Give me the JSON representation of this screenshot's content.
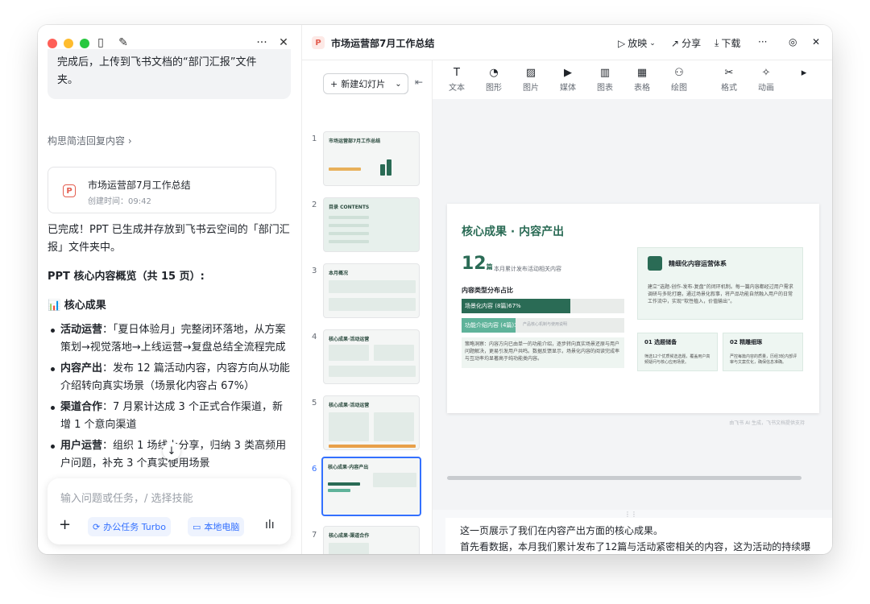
{
  "chat": {
    "top_bubble_line1": "完成后，上传到飞书文档的“部门汇报”文件",
    "top_bubble_line2": "夹。",
    "reply_link": "构思简洁回复内容 ›",
    "file_card": {
      "title": "市场运营部7月工作总结",
      "time": "创建时间：09:42"
    },
    "done_text": "已完成！PPT 已生成并存放到飞书云空间的「部门汇报」文件夹中。",
    "overview_heading": "PPT 核心内容概览（共 15 页）:",
    "results_heading": "📊 核心成果",
    "bullets": [
      {
        "label": "活动运营",
        "text": "：「夏日体验月」完整闭环落地，从方案策划→视觉落地→上线运营→复盘总结全流程完成"
      },
      {
        "label": "内容产出",
        "text": "：发布 12 篇活动内容，内容方向从功能介绍转向真实场景（场景化内容占 67%）"
      },
      {
        "label": "渠道合作",
        "text": "：7 月累计达成 3 个正式合作渠道，新增 1 个意向渠道"
      },
      {
        "label": "用户运营",
        "text": "：组织 1 场线上分享，归纳 3 类高频用户问题，补充 3 个真实使用场景"
      }
    ],
    "input_placeholder": "输入问题或任务，/ 选择技能",
    "chip_turbo": "办公任务 Turbo",
    "chip_local": "本地电脑"
  },
  "ppt": {
    "title": "市场运营部7月工作总结",
    "actions": {
      "play": "放映",
      "share": "分享",
      "download": "下载"
    },
    "new_slide": "新建幻灯片",
    "toolbar": [
      "文本",
      "图形",
      "图片",
      "媒体",
      "图表",
      "表格",
      "绘图",
      "格式",
      "动画"
    ],
    "thumbnails": [
      {
        "num": "1",
        "title": "市场运营部7月工作总结"
      },
      {
        "num": "2",
        "title": "目录 CONTENTS"
      },
      {
        "num": "3",
        "title": "本月概况"
      },
      {
        "num": "4",
        "title": "核心成果·活动运营"
      },
      {
        "num": "5",
        "title": "核心成果·活动运营"
      },
      {
        "num": "6",
        "title": "核心成果·内容产出"
      },
      {
        "num": "7",
        "title": "核心成果·渠道合作"
      }
    ],
    "slide": {
      "title": "核心成果 · 内容产出",
      "big_number": "12",
      "big_unit": "篇",
      "big_sub": "本月累计发布活动相关内容",
      "section": "内容类型分布占比",
      "bars": [
        {
          "label": "场景化内容 (8篇)67%",
          "value": 0.67,
          "color": "#2a6b55"
        },
        {
          "label": "功能介绍内容 (4篇)33%",
          "value": 0.33,
          "color": "#5fb39a"
        }
      ],
      "bar2_hint": "产品核心机制与使用说明",
      "note": "策略洞察：内容方向已由单一的功能介绍，逐步转向真实场景还原与用户问题解决，更易引发用户共鸣。数据反馈显示，场景化内容的阅读完成率与互动率均显著高于纯功能类内容。",
      "card_title": "精细化内容运营体系",
      "card_text": "建立“选题-创作-发布-复盘”的闭环机制。每一篇内容都经过用户需求调研与多轮打磨，通过场景化叙事，将产品功能自然融入用户的日常工作流中，实现“软性植入，价值输出”。",
      "sub1_title": "01 选题储备",
      "sub1_text": "筛选12个优质候选选题，覆盖用户高频疑问与核心应用场景。",
      "sub2_title": "02 精雕细琢",
      "sub2_text": "严控每篇内容的质量，历经3轮内部评审与文案优化，确保信息准确。",
      "footer": "由飞书 AI 生成，飞书文档提供支持"
    },
    "notes_line1": "这一页展示了我们在内容产出方面的核心成果。",
    "notes_line2": "首先看数据，本月我们累计发布了12篇与活动紧密相关的内容，这为活动的持续曝"
  }
}
